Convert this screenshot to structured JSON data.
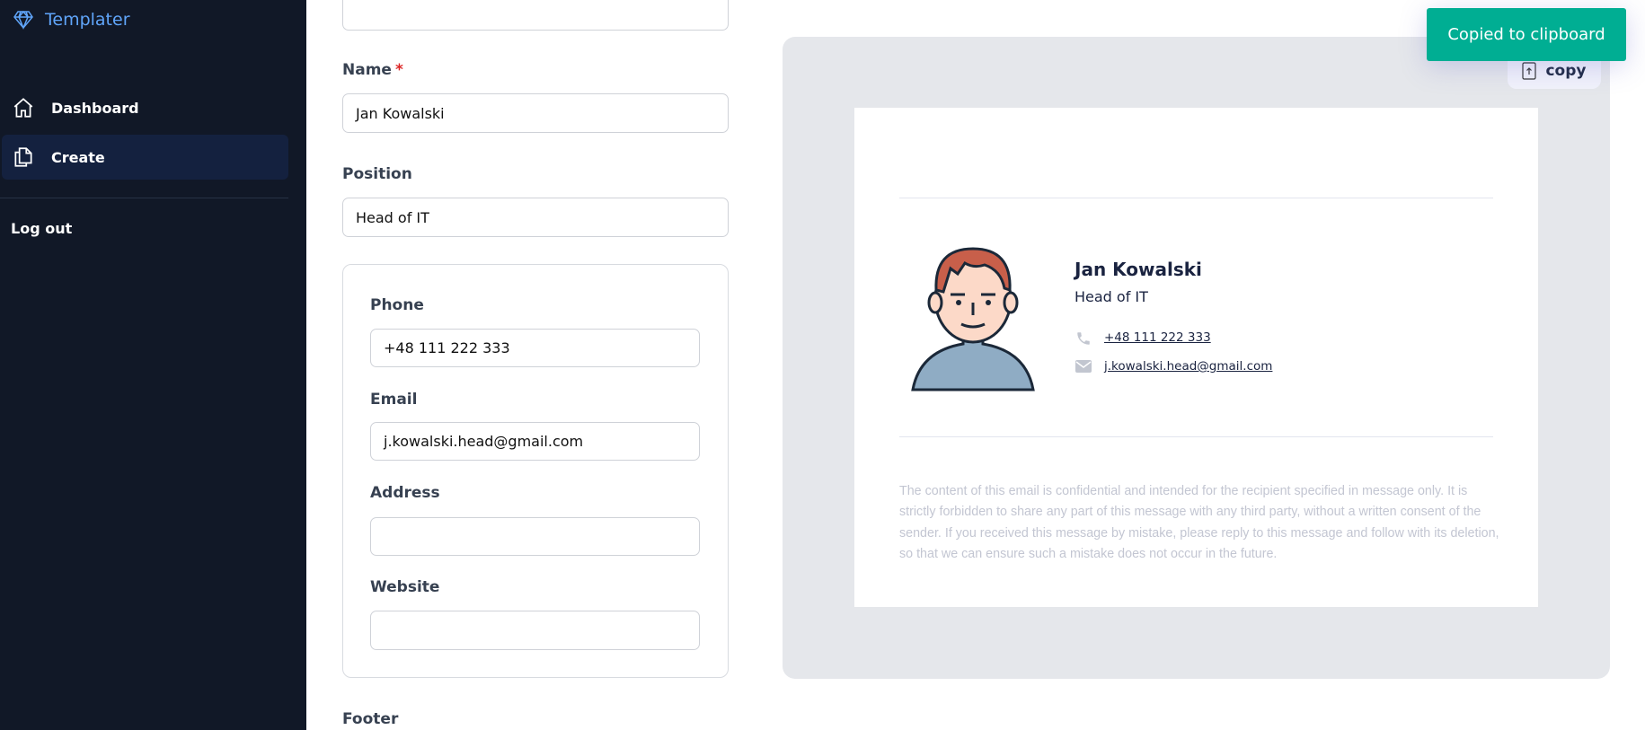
{
  "sidebar": {
    "brand": "Templater",
    "items": [
      {
        "label": "Dashboard",
        "icon": "home-icon"
      },
      {
        "label": "Create",
        "icon": "documents-icon",
        "active": true
      }
    ],
    "logout": "Log out"
  },
  "form": {
    "name": {
      "label": "Name",
      "required": "*",
      "value": "Jan Kowalski"
    },
    "position": {
      "label": "Position",
      "value": "Head of IT"
    },
    "phone": {
      "label": "Phone",
      "value": "+48 111 222 333"
    },
    "email": {
      "label": "Email",
      "value": "j.kowalski.head@gmail.com"
    },
    "address": {
      "label": "Address",
      "value": ""
    },
    "website": {
      "label": "Website",
      "value": ""
    },
    "footer": {
      "label": "Footer"
    }
  },
  "preview": {
    "copy_label": "copy",
    "name": "Jan Kowalski",
    "position": "Head of IT",
    "phone": "+48 111 222 333",
    "email": "j.kowalski.head@gmail.com",
    "disclaimer": "The content of this email is confidential and intended for the recipient specified in message only. It is strictly forbidden to share any part of this message with any third party, without a written consent of the sender. If you received this message by mistake, please reply to this message and follow with its deletion, so that we can ensure such a mistake does not occur in the future."
  },
  "toast": {
    "message": "Copied to clipboard",
    "color": "#00ae93"
  }
}
